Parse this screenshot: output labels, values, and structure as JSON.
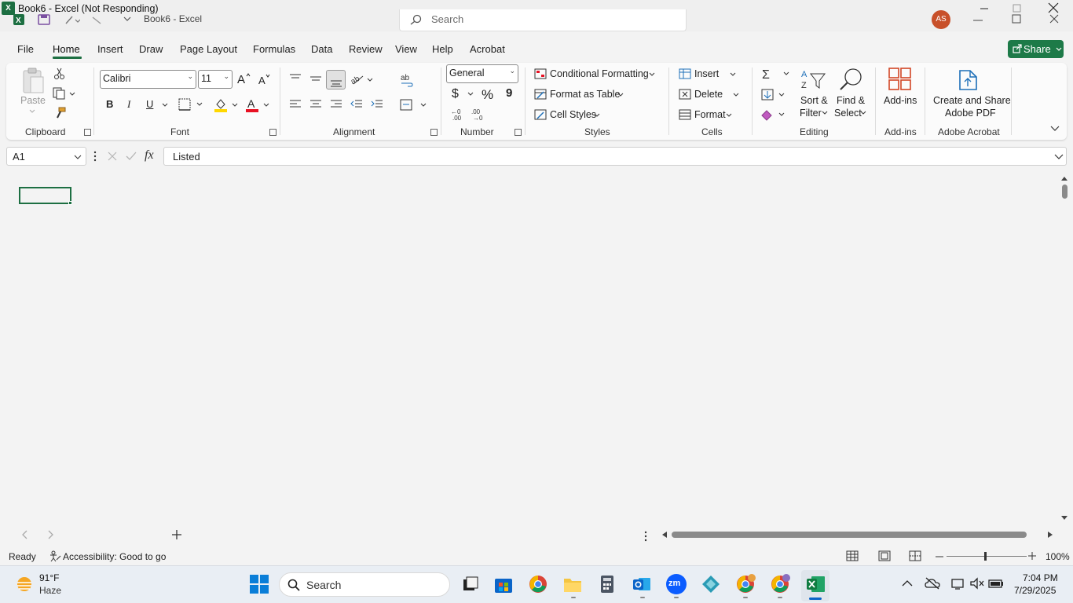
{
  "window": {
    "title": "Book6 - Excel (Not Responding)",
    "ghost_title": "Book6 - Excel",
    "app_icon_letter": "X",
    "search_placeholder": "Search",
    "avatar_initials": "AS"
  },
  "tabs": [
    "File",
    "Home",
    "Insert",
    "Draw",
    "Page Layout",
    "Formulas",
    "Data",
    "Review",
    "View",
    "Help",
    "Acrobat"
  ],
  "share_label": "Share",
  "ribbon": {
    "clipboard": {
      "label": "Clipboard",
      "paste": "Paste"
    },
    "font": {
      "label": "Font",
      "name": "Calibri",
      "size": "11",
      "bold": "B",
      "italic": "I",
      "underline": "U"
    },
    "alignment": {
      "label": "Alignment"
    },
    "number": {
      "label": "Number",
      "format": "General",
      "currency": "$",
      "percent": "%",
      "comma": "9"
    },
    "styles": {
      "label": "Styles",
      "conditional": "Conditional Formatting",
      "table": "Format as Table",
      "cell_styles": "Cell Styles"
    },
    "cells": {
      "label": "Cells",
      "insert": "Insert",
      "delete": "Delete",
      "format": "Format"
    },
    "editing": {
      "label": "Editing",
      "sort_1": "Sort &",
      "sort_2": "Filter",
      "find_1": "Find &",
      "find_2": "Select"
    },
    "addins": {
      "label": "Add-ins",
      "button": "Add-ins"
    },
    "acrobat": {
      "label": "Adobe Acrobat",
      "btn_1": "Create and Share",
      "btn_2": "Adobe PDF"
    }
  },
  "formula_bar": {
    "name_box": "A1",
    "fx": "fx",
    "content": "Listed"
  },
  "status": {
    "ready": "Ready",
    "accessibility": "Accessibility: Good to go",
    "zoom": "100%"
  },
  "taskbar": {
    "weather_temp": "91°F",
    "weather_desc": "Haze",
    "search_placeholder": "Search",
    "time": "7:04 PM",
    "date": "7/29/2025",
    "zoom_app_label": "zm"
  },
  "colors": {
    "excel_green": "#1d6f42",
    "share_green": "#1d7a48",
    "font_red": "#e81123",
    "highlight_yellow": "#ffd800"
  }
}
